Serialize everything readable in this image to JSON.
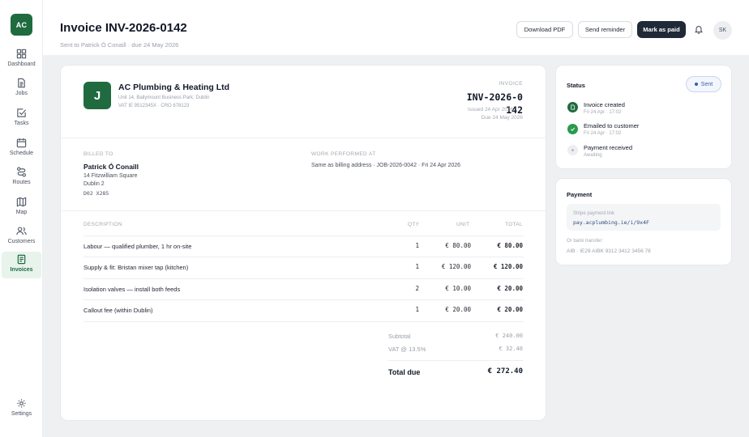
{
  "brand": {
    "initials": "AC",
    "accent": "#1f6b3f"
  },
  "sidebar": {
    "items": [
      {
        "label": "Dashboard",
        "icon": "grid-icon"
      },
      {
        "label": "Jobs",
        "icon": "document-icon"
      },
      {
        "label": "Tasks",
        "icon": "check-square-icon"
      },
      {
        "label": "Schedule",
        "icon": "calendar-icon"
      },
      {
        "label": "Routes",
        "icon": "route-icon"
      },
      {
        "label": "Map",
        "icon": "map-icon"
      },
      {
        "label": "Customers",
        "icon": "users-icon"
      },
      {
        "label": "Invoices",
        "icon": "invoice-icon",
        "active": true
      }
    ],
    "settings_label": "Settings"
  },
  "header": {
    "title": "Invoice INV-2026-0142",
    "subtitle": "Sent to Patrick Ó Conaill · due 24 May 2026",
    "download_label": "Download PDF",
    "reminder_label": "Send reminder",
    "mark_paid_label": "Mark as paid",
    "avatar_initials": "SK"
  },
  "invoice": {
    "logo_letter": "J",
    "company": {
      "name": "AC Plumbing & Heating Ltd",
      "address": "Unit 14, Ballymount Business Park, Dublin",
      "reg": "VAT IE 9512345X · CRO 678123"
    },
    "label": "INVOICE",
    "number": "INV-2026-0142",
    "issued": "Issued 24 Apr 2026",
    "due": "Due 24 May 2026",
    "billed_to": {
      "label": "BILLED TO",
      "name": "Patrick Ó Conaill",
      "line1": "14 Fitzwilliam Square",
      "line2": "Dublin 2",
      "eircode": "D02 X285"
    },
    "work": {
      "label": "WORK PERFORMED AT",
      "text": "Same as billing address · JOB-2026-0042 · Fri 24 Apr 2026"
    },
    "columns": {
      "description": "DESCRIPTION",
      "qty": "QTY",
      "unit": "UNIT",
      "total": "TOTAL"
    },
    "lines": [
      {
        "description": "Labour — qualified plumber, 1 hr on-site",
        "qty": "1",
        "unit": "€ 80.00",
        "total": "€ 80.00"
      },
      {
        "description": "Supply & fit: Bristan mixer tap (kitchen)",
        "qty": "1",
        "unit": "€ 120.00",
        "total": "€ 120.00"
      },
      {
        "description": "Isolation valves — install both feeds",
        "qty": "2",
        "unit": "€ 10.00",
        "total": "€ 20.00"
      },
      {
        "description": "Callout fee (within Dublin)",
        "qty": "1",
        "unit": "€ 20.00",
        "total": "€ 20.00"
      }
    ],
    "subtotal_label": "Subtotal",
    "subtotal": "€ 240.00",
    "vat_label": "VAT @ 13.5%",
    "vat": "€ 32.40",
    "total_label": "Total due",
    "total": "€ 272.40"
  },
  "status_card": {
    "title": "Status",
    "badge": "Sent",
    "timeline": [
      {
        "title": "Invoice created",
        "sub": "Fri 24 Apr · 17:02",
        "state": "done",
        "icon": "document-icon"
      },
      {
        "title": "Emailed to customer",
        "sub": "Fri 24 Apr · 17:02",
        "state": "done",
        "icon": "check-icon"
      },
      {
        "title": "Payment received",
        "sub": "Awaiting",
        "state": "pending",
        "icon": "dot-icon"
      }
    ]
  },
  "payment_card": {
    "title": "Payment",
    "stripe_label": "Stripe payment link",
    "stripe_link": "pay.acplumbing.ie/i/9x4F",
    "bank_label": "Or bank transfer:",
    "bank_details": "AIB · IE29 AIBK 9312 3412 3456 78"
  }
}
